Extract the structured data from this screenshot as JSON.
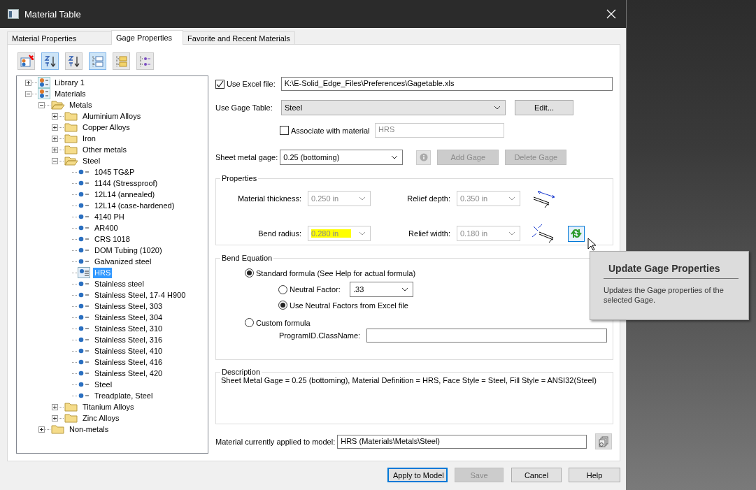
{
  "window": {
    "title": "Material Table"
  },
  "tabs": [
    {
      "label": "Material Properties",
      "selected": false
    },
    {
      "label": "Gage Properties",
      "selected": true
    },
    {
      "label": "Favorite and Recent Materials",
      "selected": false
    }
  ],
  "toolbar": [
    {
      "selected": false
    },
    {
      "selected": true
    },
    {
      "selected": false
    },
    {
      "selected": true
    },
    {
      "selected": false
    },
    {
      "selected": false
    }
  ],
  "tree": [
    {
      "label": "Library 1",
      "kind": "library",
      "expanded": false,
      "selected": false
    },
    {
      "label": "Materials",
      "kind": "library",
      "expanded": true,
      "selected": false,
      "children": [
        {
          "label": "Metals",
          "kind": "folder",
          "expanded": true,
          "selected": false,
          "children": [
            {
              "label": "Aluminium Alloys",
              "kind": "folder",
              "expanded": false,
              "selected": false
            },
            {
              "label": "Copper Alloys",
              "kind": "folder",
              "expanded": false,
              "selected": false
            },
            {
              "label": "Iron",
              "kind": "folder",
              "expanded": false,
              "selected": false
            },
            {
              "label": "Other metals",
              "kind": "folder",
              "expanded": false,
              "selected": false
            },
            {
              "label": "Steel",
              "kind": "folder",
              "expanded": true,
              "selected": false,
              "children": [
                {
                  "label": "1045 TG&P",
                  "kind": "material",
                  "selected": false
                },
                {
                  "label": "1144 (Stressproof)",
                  "kind": "material",
                  "selected": false
                },
                {
                  "label": "12L14 (annealed)",
                  "kind": "material",
                  "selected": false
                },
                {
                  "label": "12L14 (case-hardened)",
                  "kind": "material",
                  "selected": false
                },
                {
                  "label": "4140 PH",
                  "kind": "material",
                  "selected": false
                },
                {
                  "label": "AR400",
                  "kind": "material",
                  "selected": false
                },
                {
                  "label": "CRS 1018",
                  "kind": "material",
                  "selected": false
                },
                {
                  "label": "DOM Tubing (1020)",
                  "kind": "material",
                  "selected": false
                },
                {
                  "label": "Galvanized steel",
                  "kind": "material",
                  "selected": false
                },
                {
                  "label": "HRS",
                  "kind": "material",
                  "selected": true
                },
                {
                  "label": "Stainless steel",
                  "kind": "material",
                  "selected": false
                },
                {
                  "label": "Stainless Steel, 17-4 H900",
                  "kind": "material",
                  "selected": false
                },
                {
                  "label": "Stainless Steel, 303",
                  "kind": "material",
                  "selected": false
                },
                {
                  "label": "Stainless Steel, 304",
                  "kind": "material",
                  "selected": false
                },
                {
                  "label": "Stainless Steel, 310",
                  "kind": "material",
                  "selected": false
                },
                {
                  "label": "Stainless Steel, 316",
                  "kind": "material",
                  "selected": false
                },
                {
                  "label": "Stainless Steel, 410",
                  "kind": "material",
                  "selected": false
                },
                {
                  "label": "Stainless Steel, 416",
                  "kind": "material",
                  "selected": false
                },
                {
                  "label": "Stainless Steel, 420",
                  "kind": "material",
                  "selected": false
                },
                {
                  "label": "Steel",
                  "kind": "material",
                  "selected": false
                },
                {
                  "label": "Treadplate, Steel",
                  "kind": "material",
                  "selected": false
                }
              ]
            },
            {
              "label": "Titanium Alloys",
              "kind": "folder",
              "expanded": false,
              "selected": false
            },
            {
              "label": "Zinc Alloys",
              "kind": "folder",
              "expanded": false,
              "selected": false
            }
          ]
        },
        {
          "label": "Non-metals",
          "kind": "folder",
          "expanded": false,
          "selected": false
        }
      ]
    }
  ],
  "excel_file": {
    "label": "Use Excel file:",
    "checked": true,
    "value": "K:\\E-Solid_Edge_Files\\Preferences\\Gagetable.xls"
  },
  "gage_table": {
    "label": "Use Gage Table:",
    "value": "Steel",
    "button": "Edit..."
  },
  "associate": {
    "label": "Associate with material",
    "checked": false,
    "value": "HRS",
    "disabled": true
  },
  "sheet_metal_gage": {
    "label": "Sheet metal gage:",
    "value": "0.25 (bottoming)",
    "info_disabled": true,
    "buttons": [
      {
        "label": "Add Gage",
        "disabled": true
      },
      {
        "label": "Delete Gage",
        "disabled": true
      }
    ]
  },
  "properties": {
    "title": "Properties",
    "fields": [
      {
        "label": "Material thickness:",
        "value": "0.250 in",
        "disabled": true,
        "highlighted": false
      },
      {
        "label": "Relief depth:",
        "value": "0.350 in",
        "disabled": true,
        "highlighted": false
      },
      {
        "label": "Bend radius:",
        "value": "0.280 in",
        "disabled": true,
        "highlighted": true
      },
      {
        "label": "Relief width:",
        "value": "0.180 in",
        "disabled": true,
        "highlighted": false
      }
    ]
  },
  "bend_equation": {
    "title": "Bend Equation",
    "options": [
      {
        "label": "Standard formula (See Help for actual formula)",
        "selected": true
      },
      {
        "label": "Custom formula",
        "selected": false
      }
    ],
    "sub_options": [
      {
        "label": "Neutral Factor:",
        "selected": false,
        "value": ".33"
      },
      {
        "label": "Use Neutral Factors from Excel file",
        "selected": true
      }
    ],
    "class_name_label": "ProgramID.ClassName:"
  },
  "description": {
    "title": "Description",
    "text": "Sheet Metal Gage = 0.25 (bottoming), Material Definition = HRS, Face Style = Steel, Fill Style = ANSI32(Steel)"
  },
  "applied_material": {
    "label": "Material currently applied to model:",
    "value": "HRS (Materials\\Metals\\Steel)"
  },
  "buttons": [
    {
      "label": "Apply to Model",
      "disabled": false,
      "default": true
    },
    {
      "label": "Save",
      "disabled": true,
      "default": false
    },
    {
      "label": "Cancel",
      "disabled": false,
      "default": false
    },
    {
      "label": "Help",
      "disabled": false,
      "default": false
    }
  ],
  "tooltip": {
    "title": "Update Gage Properties",
    "text": "Updates the Gage properties of the selected Gage."
  }
}
